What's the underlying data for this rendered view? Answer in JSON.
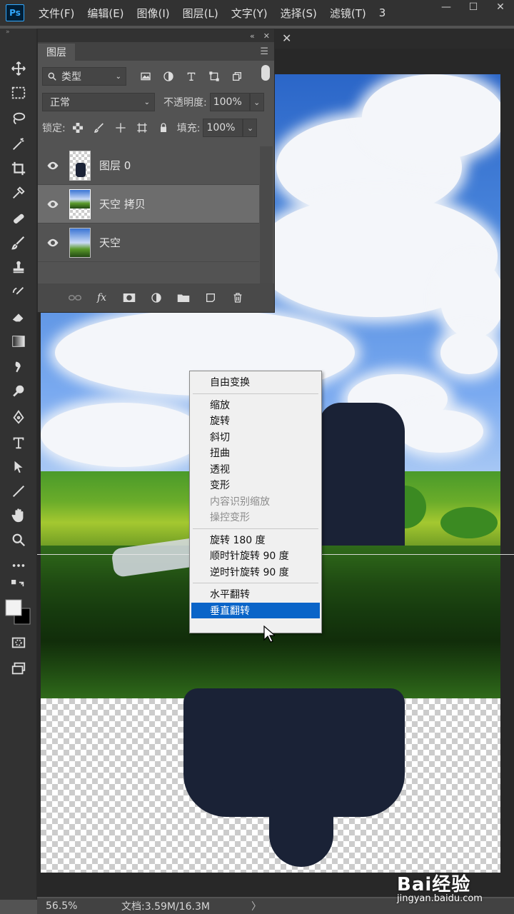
{
  "app": {
    "logo": "Ps"
  },
  "menu": [
    "文件(F)",
    "编辑(E)",
    "图像(I)",
    "图层(L)",
    "文字(Y)",
    "选择(S)",
    "滤镜(T)",
    "3"
  ],
  "window_controls": [
    "—",
    "☐",
    "✕"
  ],
  "panel": {
    "collapse_glyph": "«",
    "close_glyph": "✕",
    "tab": "图层",
    "filter_label": "类型",
    "blend_mode": "正常",
    "opacity_label": "不透明度:",
    "opacity_value": "100%",
    "lock_label": "锁定:",
    "fill_label": "填充:",
    "fill_value": "100%",
    "layers": [
      {
        "name": "图层 0",
        "selected": false
      },
      {
        "name": "天空 拷贝",
        "selected": true
      },
      {
        "name": "天空",
        "selected": false
      }
    ]
  },
  "context_menu": {
    "items": [
      {
        "label": "自由变换",
        "state": "normal"
      },
      {
        "label": "缩放",
        "state": "normal"
      },
      {
        "label": "旋转",
        "state": "normal"
      },
      {
        "label": "斜切",
        "state": "normal"
      },
      {
        "label": "扭曲",
        "state": "normal"
      },
      {
        "label": "透视",
        "state": "normal"
      },
      {
        "label": "变形",
        "state": "normal"
      },
      {
        "label": "内容识别缩放",
        "state": "disabled"
      },
      {
        "label": "操控变形",
        "state": "disabled"
      },
      {
        "label": "旋转 180 度",
        "state": "normal"
      },
      {
        "label": "顺时针旋转 90 度",
        "state": "normal"
      },
      {
        "label": "逆时针旋转 90 度",
        "state": "normal"
      },
      {
        "label": "水平翻转",
        "state": "normal"
      },
      {
        "label": "垂直翻转",
        "state": "highlighted"
      }
    ]
  },
  "status": {
    "zoom": "56.5%",
    "doc": "文档:3.59M/16.3M",
    "arrow": "〉"
  },
  "watermark": {
    "logo": "Bai经验",
    "url": "jingyan.baidu.com"
  },
  "colors": {
    "highlight": "#0a64c8",
    "ui_dark": "#323232",
    "panel": "#535353"
  }
}
